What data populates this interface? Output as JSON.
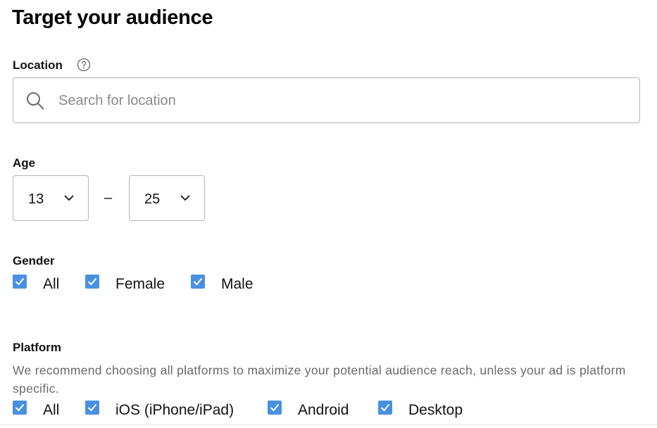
{
  "page": {
    "title": "Target your audience"
  },
  "location": {
    "label": "Location",
    "placeholder": "Search for location",
    "value": ""
  },
  "age": {
    "label": "Age",
    "min": "13",
    "separator": "–",
    "max": "25"
  },
  "gender": {
    "label": "Gender",
    "options": [
      {
        "label": "All",
        "checked": true
      },
      {
        "label": "Female",
        "checked": true
      },
      {
        "label": "Male",
        "checked": true
      }
    ]
  },
  "platform": {
    "label": "Platform",
    "note": "We recommend choosing all platforms to maximize your potential audience reach, unless your ad is platform specific.",
    "options": [
      {
        "label": "All",
        "checked": true
      },
      {
        "label": "iOS (iPhone/iPad)",
        "checked": true
      },
      {
        "label": "Android",
        "checked": true
      },
      {
        "label": "Desktop",
        "checked": true
      }
    ]
  },
  "colors": {
    "checkbox": "#4a90e2",
    "border": "#b3b3b3",
    "muted_text": "#6a6a6a"
  },
  "icons": {
    "help": "question-circle-icon",
    "search": "search-icon",
    "chevron": "chevron-down-icon",
    "check": "check-icon"
  }
}
